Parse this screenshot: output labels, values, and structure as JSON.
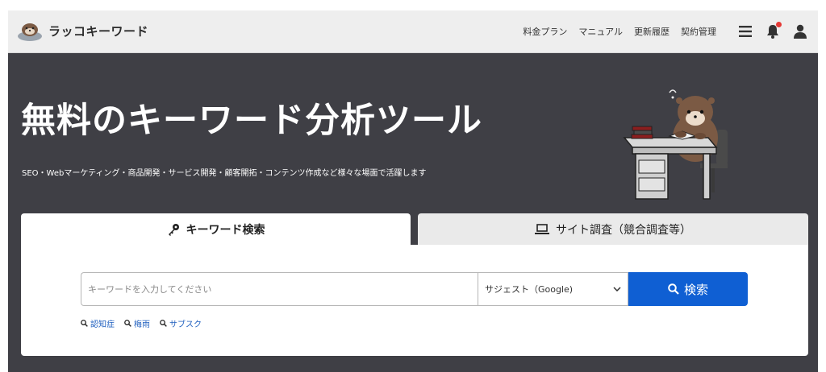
{
  "header": {
    "brand": "ラッコキーワード",
    "nav": [
      "料金プラン",
      "マニュアル",
      "更新履歴",
      "契約管理"
    ]
  },
  "hero": {
    "title": "無料のキーワード分析ツール",
    "subtitle": "SEO・Webマーケティング・商品開発・サービス開発・顧客開拓・コンテンツ作成など様々な場面で活躍します"
  },
  "tabs": [
    {
      "label": "キーワード検索",
      "icon": "key-icon",
      "active": true
    },
    {
      "label": "サイト調査（競合調査等）",
      "icon": "laptop-icon",
      "active": false
    }
  ],
  "search": {
    "placeholder": "キーワードを入力してください",
    "select_value": "サジェスト（Google)",
    "button_label": "検索"
  },
  "suggestions": [
    "認知症",
    "梅雨",
    "サブスク"
  ],
  "colors": {
    "accent": "#0f5fd3",
    "hero_bg": "#3f3f45",
    "link": "#1f5fbf",
    "notify": "#e53935"
  }
}
